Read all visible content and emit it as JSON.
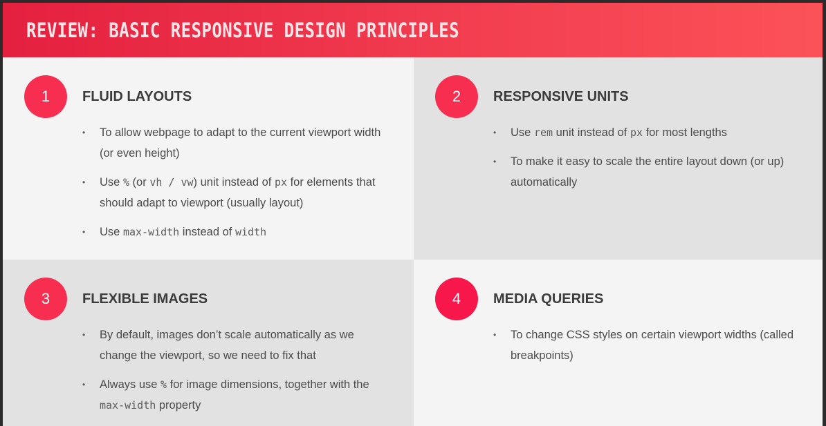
{
  "header": {
    "title": "REVIEW: BASIC RESPONSIVE DESIGN PRINCIPLES"
  },
  "sections": [
    {
      "number": "1",
      "title": "FLUID LAYOUTS",
      "b1": {
        "text": "To allow webpage to adapt to the current viewport width (or even height)"
      },
      "b2": {
        "t1": "Use ",
        "c1": "%",
        "t2": " (or ",
        "c2": "vh / vw",
        "t3": ") unit instead of ",
        "c3": "px",
        "t4": " for elements that should adapt to viewport (usually layout)"
      },
      "b3": {
        "t1": "Use ",
        "c1": "max-width",
        "t2": " instead of ",
        "c2": "width"
      }
    },
    {
      "number": "2",
      "title": "RESPONSIVE UNITS",
      "b1": {
        "t1": "Use ",
        "c1": "rem",
        "t2": " unit instead of ",
        "c2": "px",
        "t3": " for most lengths"
      },
      "b2": {
        "text": "To make it easy to scale the entire layout down (or up) automatically"
      }
    },
    {
      "number": "3",
      "title": "FLEXIBLE IMAGES",
      "b1": {
        "text": "By default, images don’t scale automatically as we change the viewport, so we need to fix that"
      },
      "b2": {
        "t1": "Always use ",
        "c1": "%",
        "t2": " for image dimensions, together with the ",
        "c2": "max-width",
        "t3": " property"
      }
    },
    {
      "number": "4",
      "title": "MEDIA QUERIES",
      "b1": {
        "text": "To change CSS styles on certain viewport widths (called breakpoints)"
      }
    }
  ]
}
